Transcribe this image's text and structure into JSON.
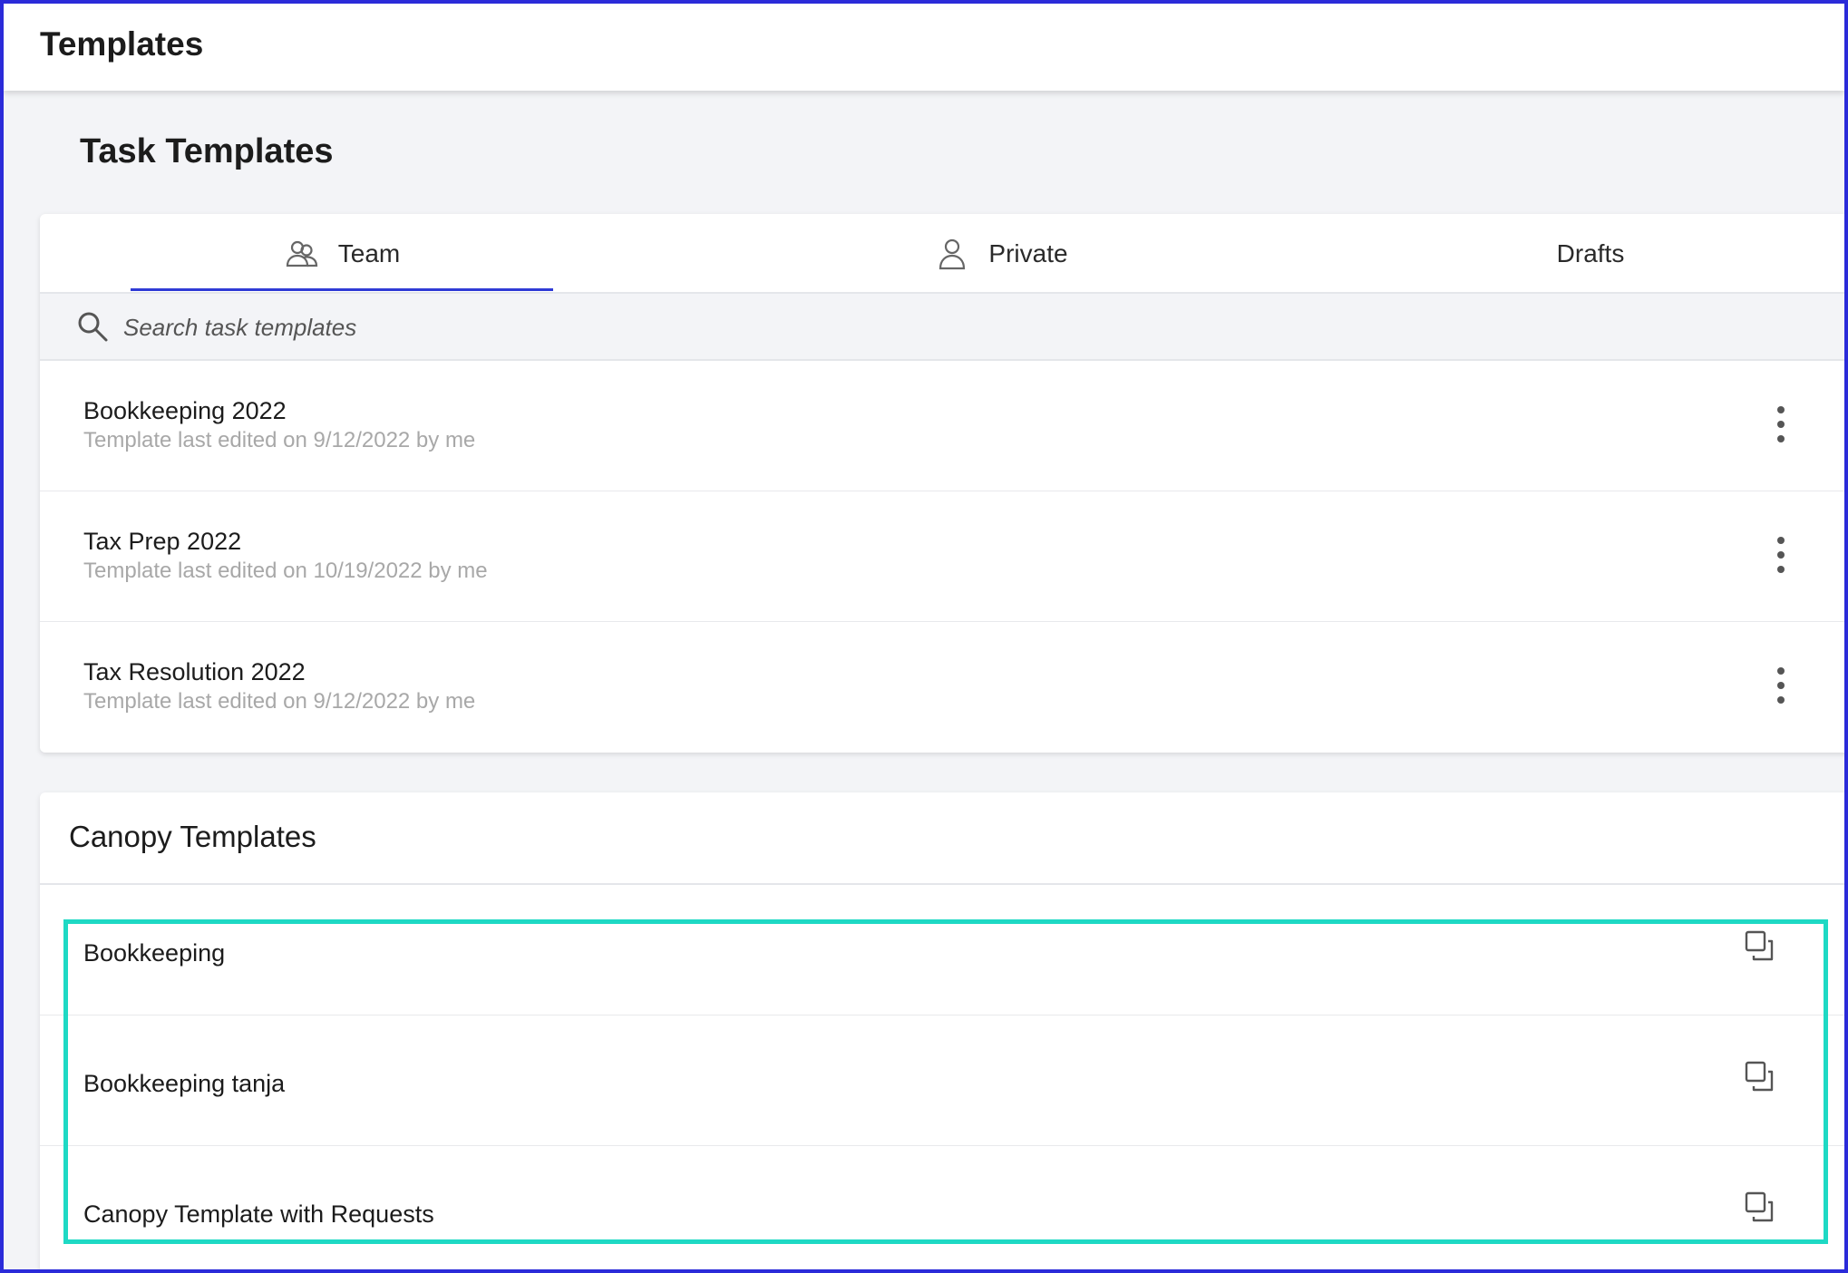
{
  "header": {
    "title": "Templates"
  },
  "page": {
    "section_title": "Task Templates"
  },
  "tabs": [
    {
      "label": "Team",
      "icon": "team-icon",
      "active": true
    },
    {
      "label": "Private",
      "icon": "user-icon",
      "active": false
    },
    {
      "label": "Drafts",
      "icon": "",
      "active": false
    }
  ],
  "search": {
    "placeholder": "Search task templates",
    "value": ""
  },
  "task_templates": [
    {
      "name": "Bookkeeping 2022",
      "meta": "Template last edited on 9/12/2022 by me"
    },
    {
      "name": "Tax Prep 2022",
      "meta": "Template last edited on 10/19/2022 by me"
    },
    {
      "name": "Tax Resolution 2022",
      "meta": "Template last edited on 9/12/2022 by me"
    }
  ],
  "canopy": {
    "title": "Canopy Templates",
    "items": [
      {
        "name": "Bookkeeping",
        "icon": "copy-icon"
      },
      {
        "name": "Bookkeeping tanja",
        "icon": "copy-icon"
      },
      {
        "name": "Canopy Template with Requests",
        "icon": "copy-icon"
      }
    ]
  },
  "colors": {
    "active_tab_underline": "#2f3bd6",
    "highlight_border": "#1ed9c4",
    "frame_border": "#2b2bd9"
  }
}
